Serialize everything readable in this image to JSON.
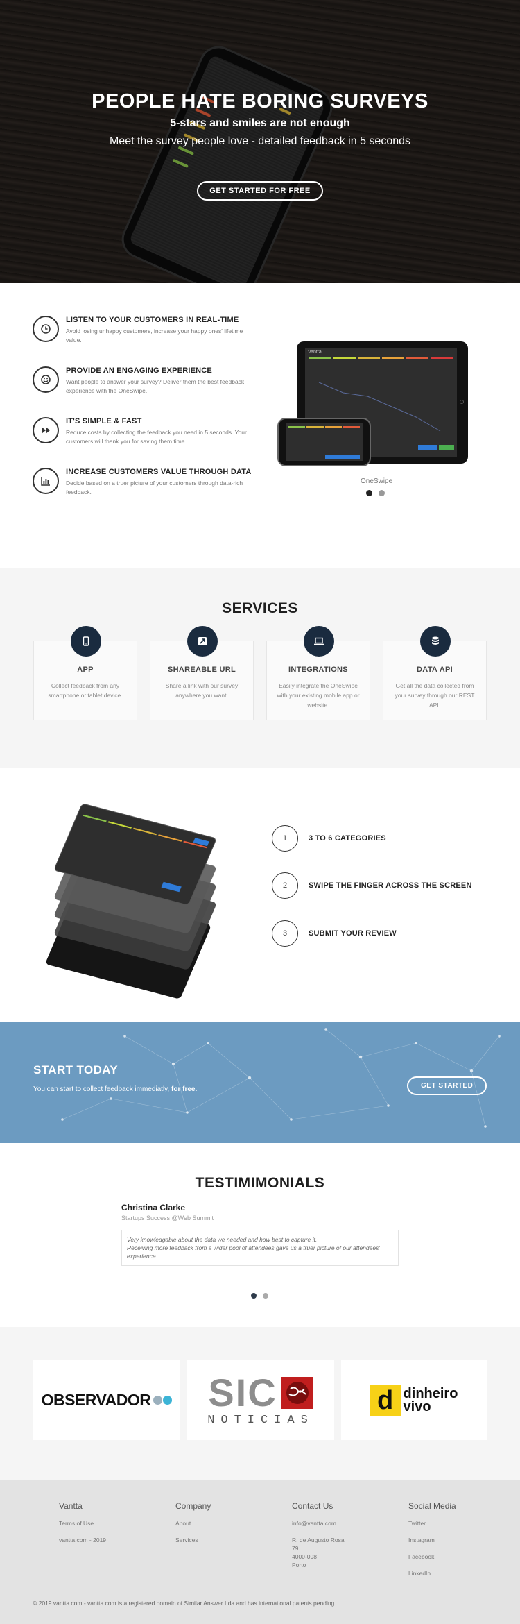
{
  "hero": {
    "title": "PEOPLE HATE BORING SURVEYS",
    "subtitle1": "5-stars and smiles are not enough",
    "subtitle2": "Meet the survey people love - detailed feedback in 5 seconds",
    "cta": "GET STARTED FOR FREE"
  },
  "features": {
    "items": [
      {
        "icon": "clock-icon",
        "title": "LISTEN TO YOUR CUSTOMERS IN REAL-TIME",
        "desc": "Avoid losing unhappy customers, increase your happy ones' lifetime value."
      },
      {
        "icon": "smile-icon",
        "title": "PROVIDE AN ENGAGING EXPERIENCE",
        "desc": "Want people to answer your survey? Deliver them the best feedback experience with the OneSwipe."
      },
      {
        "icon": "fast-forward-icon",
        "title": "IT'S SIMPLE & FAST",
        "desc": "Reduce costs by collecting the feedback you need in 5 seconds. Your customers will thank you for saving them time."
      },
      {
        "icon": "bar-chart-icon",
        "title": "INCREASE CUSTOMERS VALUE THROUGH DATA",
        "desc": "Decide based on a truer picture of your customers through data-rich feedback."
      }
    ],
    "device_brand": "Vantta",
    "carousel_label": "OneSwipe"
  },
  "services": {
    "title": "SERVICES",
    "items": [
      {
        "icon": "mobile-icon",
        "title": "APP",
        "desc": "Collect feedback from any smartphone or tablet device."
      },
      {
        "icon": "share-link-icon",
        "title": "SHAREABLE URL",
        "desc": "Share a link with our survey anywhere you want."
      },
      {
        "icon": "laptop-icon",
        "title": "INTEGRATIONS",
        "desc": "Easily integrate the OneSwipe with your existing mobile app or website."
      },
      {
        "icon": "database-icon",
        "title": "DATA API",
        "desc": "Get all the data collected from your survey through our REST API."
      }
    ]
  },
  "steps": {
    "items": [
      {
        "num": "1",
        "text": "3 TO 6 CATEGORIES"
      },
      {
        "num": "2",
        "text": "SWIPE THE FINGER ACROSS THE SCREEN"
      },
      {
        "num": "3",
        "text": "SUBMIT YOUR REVIEW"
      }
    ]
  },
  "start": {
    "title": "START TODAY",
    "text_prefix": "You can start to collect feedback immediatly, ",
    "text_bold": "for free.",
    "cta": "GET STARTED"
  },
  "testimonials": {
    "title": "TESTIMIMONIALS",
    "name": "Christina Clarke",
    "role": "Startups Success @Web Summit",
    "quote_line1": "Very knowledgable about the data we needed and how best to capture it.",
    "quote_line2": "Receiving more feedback from a wider pool of attendees gave us a truer picture of our attendees' experience."
  },
  "logos": {
    "observador": "OBSERVADOR",
    "sic_main": "SIC",
    "sic_sub": "NOTICIAS",
    "dinheiro_1": "dinheiro",
    "dinheiro_2": "vivo"
  },
  "footer": {
    "col1": {
      "heading": "Vantta",
      "links": [
        "Terms of Use",
        "vantta.com - 2019"
      ]
    },
    "col2": {
      "heading": "Company",
      "links": [
        "About",
        "Services"
      ]
    },
    "col3": {
      "heading": "Contact Us",
      "email": "info@vantta.com",
      "address": [
        "R. de Augusto Rosa",
        "79",
        "4000-098",
        "Porto"
      ]
    },
    "col4": {
      "heading": "Social Media",
      "links": [
        "Twitter",
        "Instagram",
        "Facebook",
        "LinkedIn"
      ]
    },
    "copyright": "© 2019 vantta.com - vantta.com is a registered domain of Similar Answer Lda and has international patents pending."
  },
  "colors": {
    "navy": "#1a2b3f",
    "start_blue": "#6c9bc1",
    "services_bg": "#f5f5f5",
    "footer_bg": "#e3e3e3"
  }
}
